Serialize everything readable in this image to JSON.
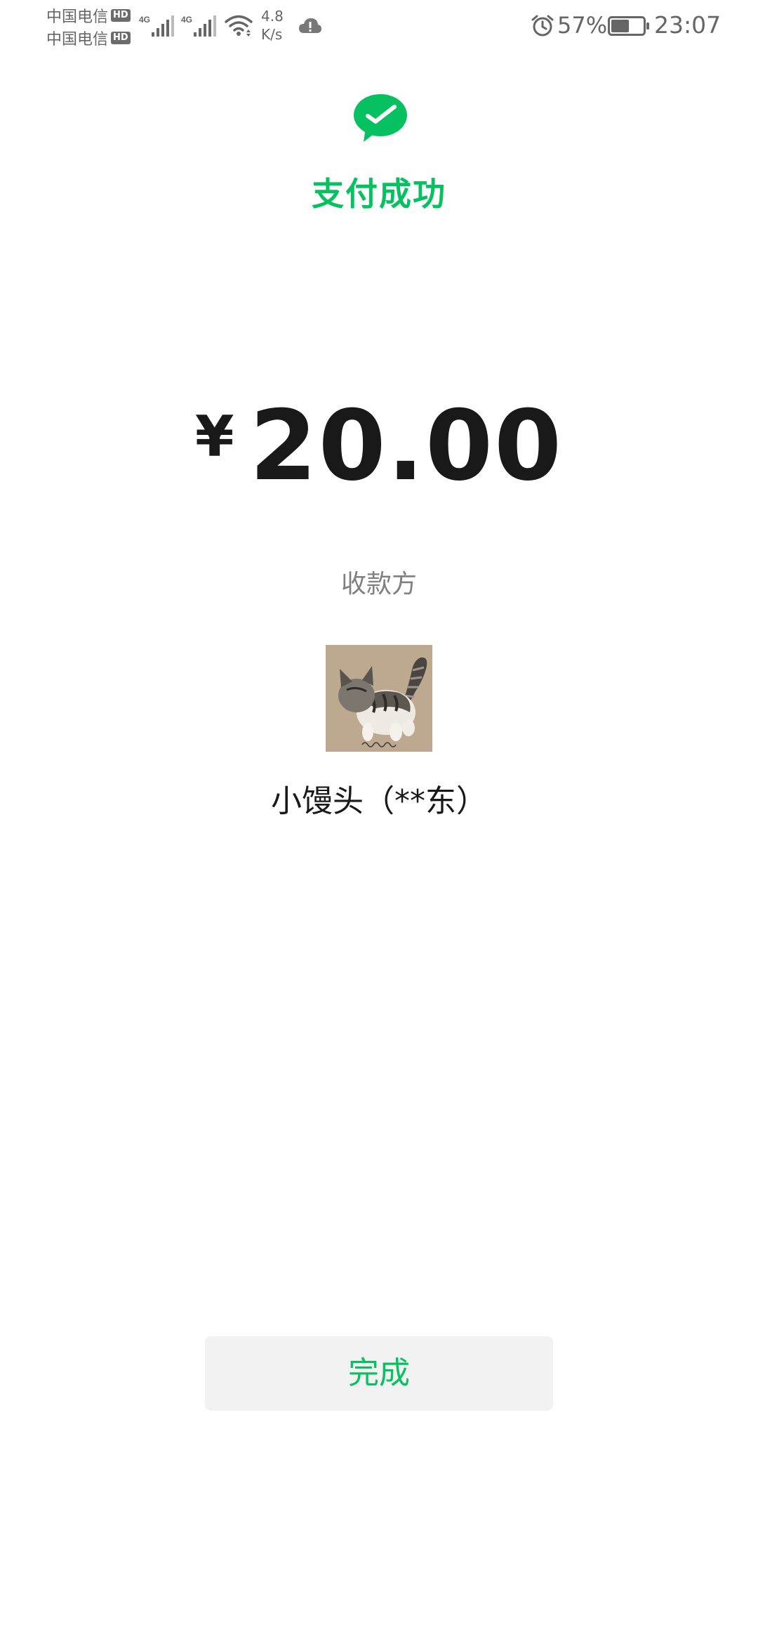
{
  "status_bar": {
    "carrier_1": "中国电信",
    "carrier_2": "中国电信",
    "hd_badge": "HD",
    "network_type": "4G",
    "net_speed_value": "4.8",
    "net_speed_unit": "K/s",
    "battery_percent": "57%",
    "battery_level": 0.57,
    "time": "23:07",
    "icons": [
      "signal-icon",
      "signal-icon",
      "wifi-icon",
      "cloud-alert-icon",
      "alarm-icon",
      "battery-icon"
    ]
  },
  "result": {
    "icon": "wechat-pay-check-icon",
    "title": "支付成功",
    "currency_symbol": "¥",
    "amount": "20.00",
    "payee_label": "收款方",
    "payee_avatar": "cat-avatar",
    "payee_name": "小馒头（**东）"
  },
  "actions": {
    "done_label": "完成"
  },
  "colors": {
    "accent": "#07c160",
    "text_primary": "#191919",
    "text_secondary": "#808080",
    "button_bg": "#f2f2f2",
    "status_text": "#666666"
  }
}
